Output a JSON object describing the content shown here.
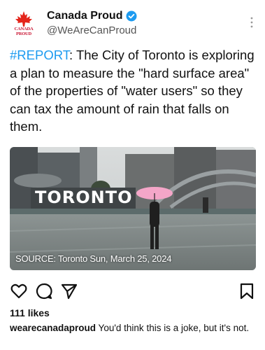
{
  "post": {
    "author": {
      "display_name": "Canada Proud",
      "handle": "@WeAreCanProud",
      "avatar_text": "CANADA PROUD",
      "verified": true
    },
    "hashtag": "#REPORT",
    "body": ": The City of Toronto is exploring a plan to measure the \"hard surface area\" of the properties of \"water users\" so they can tax the amount of rain that falls on them.",
    "image": {
      "sign_text": "TORONTO",
      "source_caption": "SOURCE: Toronto Sun, March 25, 2024"
    }
  },
  "footer": {
    "likes": "111 likes",
    "caption_user": "wearecanadaproud",
    "caption_text": " You'd think this is a joke, but it's not."
  },
  "icons": {
    "like": "heart-icon",
    "comment": "comment-icon",
    "share": "send-icon",
    "save": "bookmark-icon",
    "more": "more-icon",
    "verified": "verified-badge-icon"
  },
  "colors": {
    "hashtag": "#1d9bf0",
    "verified": "#1d9bf0",
    "brand_red": "#c8102e",
    "umbrella": "#f4a6c8"
  }
}
